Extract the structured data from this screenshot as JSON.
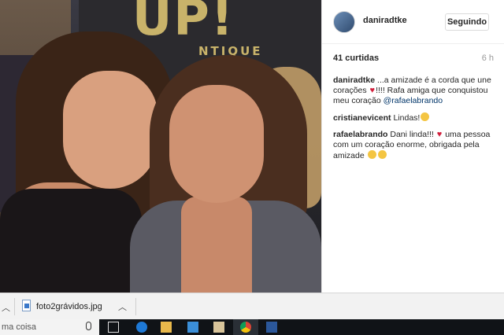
{
  "post": {
    "username": "daniradtke",
    "follow_label": "Seguindo",
    "likes": "41 curtidas",
    "time": "6 h",
    "photo": {
      "sign_big": "UP!",
      "sign_small": "NTIQUE"
    }
  },
  "comments": [
    {
      "user": "daniradtke",
      "text_before": " ...a amizade é a corda que une corações ",
      "text_after": "!!!! Rafa amiga que conquistou meu coração ",
      "mention": "@rafaelabrando"
    },
    {
      "user": "cristianevicent",
      "text": " Lindas!"
    },
    {
      "user": "rafaelabrando",
      "text_before": " Dani linda!!! ",
      "text_after": " uma pessoa com um coração enorme, obrigada pela amizade "
    }
  ],
  "download_bar": {
    "filename": "foto2grávidos.jpg"
  },
  "taskbar": {
    "search_text": "ma coisa"
  },
  "colors": {
    "heart": "#d21f3c",
    "mention": "#003569"
  }
}
